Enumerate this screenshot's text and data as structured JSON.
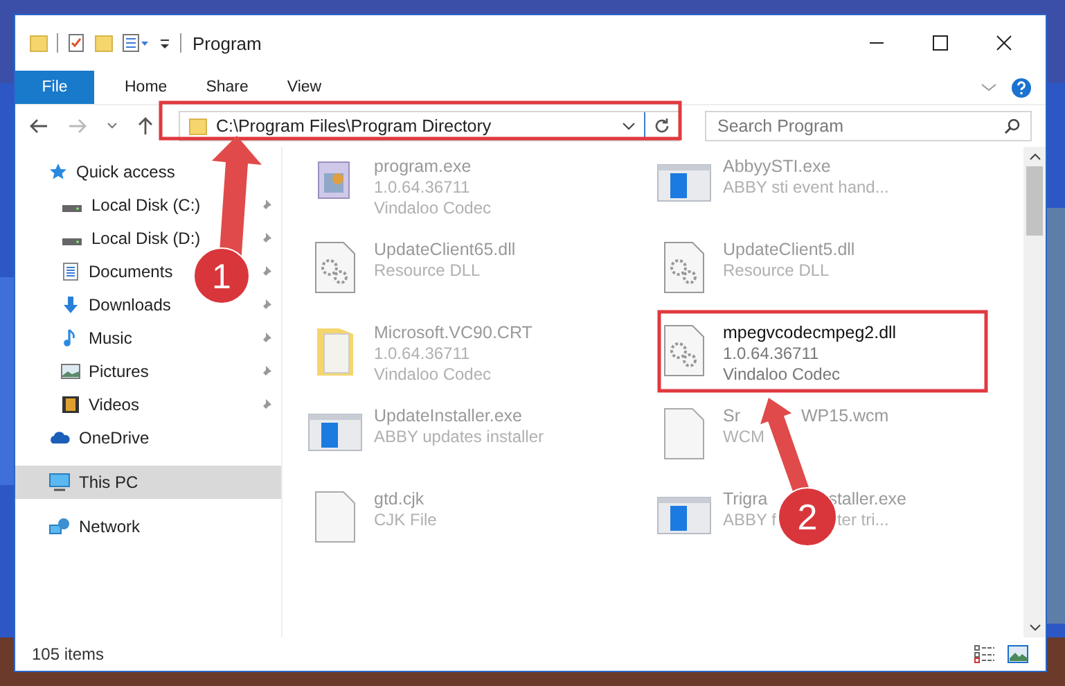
{
  "window": {
    "title": "Program"
  },
  "ribbon_tabs": [
    {
      "label": "File",
      "selected": true
    },
    {
      "label": "Home",
      "selected": false
    },
    {
      "label": "Share",
      "selected": false
    },
    {
      "label": "View",
      "selected": false
    }
  ],
  "address": {
    "value": "C:\\Program Files\\Program Directory"
  },
  "search": {
    "placeholder": "Search Program"
  },
  "sidebar": {
    "items": [
      {
        "label": "Quick access",
        "kind": "star",
        "selected": false,
        "children": [
          {
            "label": "Local Disk (C:)",
            "kind": "disk",
            "pinned": true
          },
          {
            "label": "Local Disk (D:)",
            "kind": "disk",
            "pinned": true
          },
          {
            "label": "Documents",
            "kind": "doc",
            "pinned": true
          },
          {
            "label": "Downloads",
            "kind": "download",
            "pinned": true
          },
          {
            "label": "Music",
            "kind": "music",
            "pinned": true
          },
          {
            "label": "Pictures",
            "kind": "pictures",
            "pinned": true
          },
          {
            "label": "Videos",
            "kind": "video",
            "pinned": true
          }
        ]
      },
      {
        "label": "OneDrive",
        "kind": "cloud",
        "selected": false
      },
      {
        "label": "This PC",
        "kind": "pc",
        "selected": true
      },
      {
        "label": "Network",
        "kind": "network",
        "selected": false
      }
    ]
  },
  "files": [
    {
      "kind": "app",
      "name": [
        "program.exe"
      ],
      "lines": [
        [
          "1.0.64.36711"
        ],
        [
          "Vindaloo Codec"
        ]
      ],
      "highlighted": false
    },
    {
      "kind": "installer",
      "name": [
        "AbbyySTI.exe"
      ],
      "lines": [
        [
          "ABBY sti event hand..."
        ]
      ],
      "highlighted": false
    },
    {
      "kind": "dll",
      "name": [
        "UpdateClient65.dll"
      ],
      "lines": [
        [
          "Resource DLL"
        ]
      ],
      "highlighted": false
    },
    {
      "kind": "dll",
      "name": [
        "UpdateClient5.dll"
      ],
      "lines": [
        [
          "Resource DLL"
        ]
      ],
      "highlighted": false
    },
    {
      "kind": "folder",
      "name": [
        "Microsoft.VC90.CRT"
      ],
      "lines": [
        [
          "1.0.64.36711"
        ],
        [
          "Vindaloo Codec"
        ]
      ],
      "highlighted": false
    },
    {
      "kind": "dll",
      "name": [
        "mpegvcodecmpeg2.dll"
      ],
      "lines": [
        [
          "1.0.64.36711"
        ],
        [
          "Vindaloo Codec"
        ]
      ],
      "highlighted": true
    },
    {
      "kind": "installer",
      "name": [
        "UpdateInstaller.exe"
      ],
      "lines": [
        [
          "ABBY updates installer"
        ]
      ],
      "highlighted": false
    },
    {
      "kind": "blank",
      "name": [
        "Sr",
        "WP15.wcm"
      ],
      "lines": [
        [
          "WCM"
        ]
      ],
      "highlighted": false
    },
    {
      "kind": "blank",
      "name": [
        "gtd.cjk"
      ],
      "lines": [
        [
          "CJK File"
        ]
      ],
      "highlighted": false
    },
    {
      "kind": "installer",
      "name": [
        "Trigra",
        "staller.exe"
      ],
      "lines": [
        [
          "ABBY f",
          "ter tri..."
        ]
      ],
      "highlighted": false
    }
  ],
  "status_bar": {
    "count": "105 items"
  },
  "callouts": [
    {
      "number": "1"
    },
    {
      "number": "2"
    }
  ]
}
